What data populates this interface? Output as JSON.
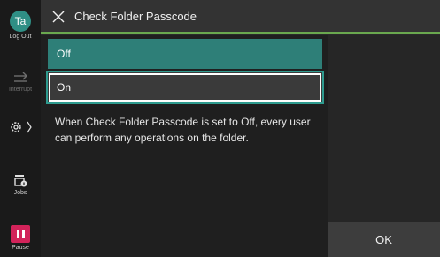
{
  "sidebar": {
    "user_initials": "Ta",
    "logout_label": "Log Out",
    "interrupt_label": "Interrupt",
    "jobs_label": "Jobs",
    "pause_label": "Pause"
  },
  "header": {
    "title": "Check Folder Passcode"
  },
  "options": [
    {
      "label": "Off"
    },
    {
      "label": "On"
    }
  ],
  "note": "When Check Folder Passcode is set to Off, every user can perform any operations on the folder.",
  "ok_label": "OK",
  "colors": {
    "accent": "#2e7f78",
    "header_line": "#6aa84f",
    "pause": "#d2235a"
  }
}
